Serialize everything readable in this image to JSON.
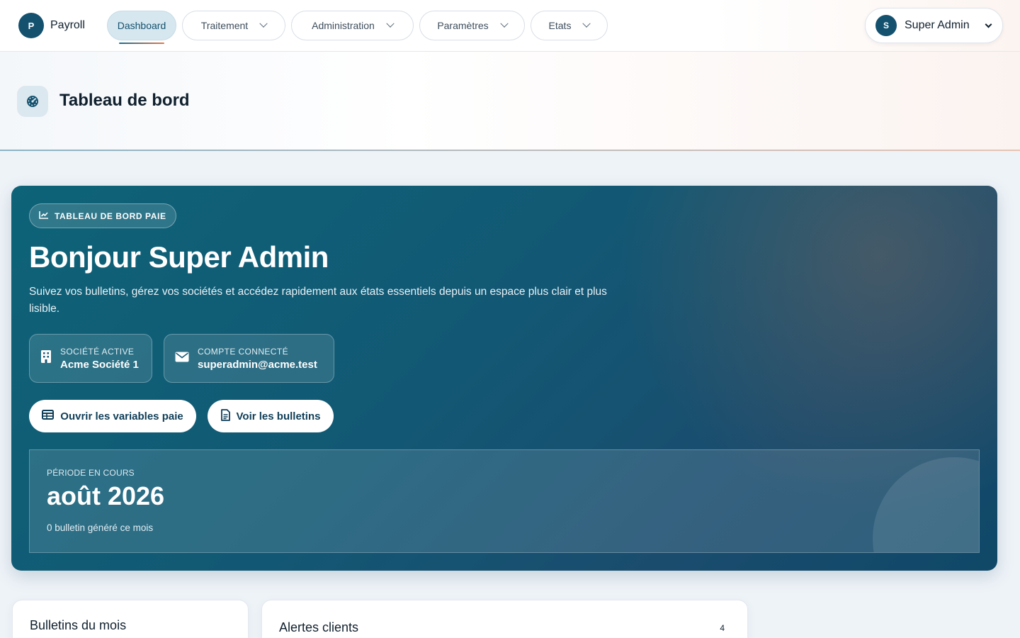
{
  "app": {
    "logo_letter": "P",
    "name": "Payroll"
  },
  "nav": {
    "items": [
      {
        "label": "Dashboard",
        "active": true,
        "has_dropdown": false
      },
      {
        "label": "Traitement",
        "active": false,
        "has_dropdown": true
      },
      {
        "label": "Administration",
        "active": false,
        "has_dropdown": true
      },
      {
        "label": "Paramètres",
        "active": false,
        "has_dropdown": true
      },
      {
        "label": "Etats",
        "active": false,
        "has_dropdown": true
      }
    ]
  },
  "user": {
    "initial": "S",
    "name": "Super Admin"
  },
  "page": {
    "title": "Tableau de bord",
    "icon": "gauge-icon"
  },
  "hero": {
    "badge": "TABLEAU DE BORD PAIE",
    "title": "Bonjour Super Admin",
    "subtitle": "Suivez vos bulletins, gérez vos sociétés et accédez rapidement aux états essentiels depuis un espace plus clair et plus lisible.",
    "company": {
      "label": "SOCIÉTÉ ACTIVE",
      "value": "Acme Société 1"
    },
    "account": {
      "label": "COMPTE CONNECTÉ",
      "value": "superadmin@acme.test"
    },
    "buttons": {
      "variables": "Ouvrir les variables paie",
      "bulletins": "Voir les bulletins"
    },
    "period": {
      "label": "PÉRIODE EN COURS",
      "value": "août 2026",
      "note": "0 bulletin généré ce mois"
    }
  },
  "cards": {
    "bulletins": {
      "title": "Bulletins du mois"
    },
    "alertes": {
      "title": "Alertes clients",
      "count": "4"
    }
  },
  "colors": {
    "brand": "#13516e",
    "accent": "#e07a4c",
    "hero_start": "#0e6378",
    "hero_end": "#0f4868"
  }
}
